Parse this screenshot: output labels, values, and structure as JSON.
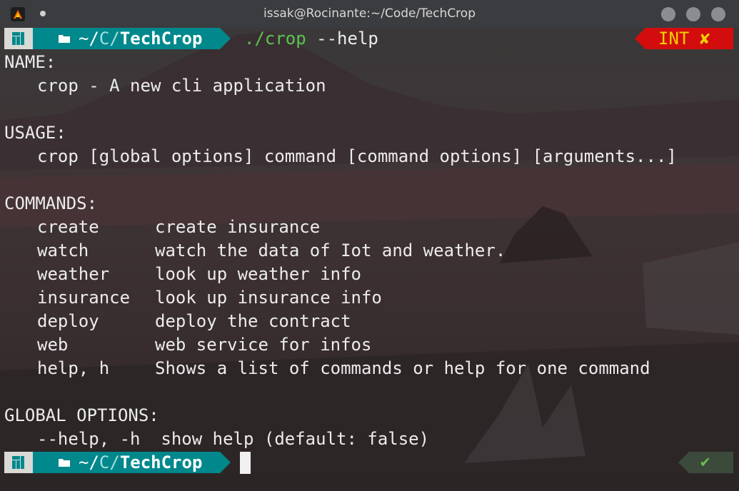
{
  "window": {
    "title": "issak@Rocinante:~/Code/TechCrop"
  },
  "prompt1": {
    "dir_home": "~/",
    "dir_mid": "C/",
    "dir_name": "TechCrop",
    "cmd_path": "./crop",
    "cmd_args": " --help"
  },
  "status_int": {
    "label": "INT",
    "icon": "✘"
  },
  "help": {
    "name_header": "NAME:",
    "name_line": "crop - A new cli application",
    "usage_header": "USAGE:",
    "usage_line": "crop [global options] command [command options] [arguments...]",
    "commands_header": "COMMANDS:",
    "commands": [
      {
        "name": "create",
        "desc": "create insurance"
      },
      {
        "name": "watch",
        "desc": "watch the data of Iot and weather."
      },
      {
        "name": "weather",
        "desc": "look up weather info"
      },
      {
        "name": "insurance",
        "desc": "look up insurance info"
      },
      {
        "name": "deploy",
        "desc": "deploy the contract"
      },
      {
        "name": "web",
        "desc": "web service for infos"
      },
      {
        "name": "help, h",
        "desc": "Shows a list of commands or help for one command"
      }
    ],
    "global_header": "GLOBAL OPTIONS:",
    "global_line": "--help, -h  show help (default: false)"
  },
  "prompt2": {
    "dir_home": "~/",
    "dir_mid": "C/",
    "dir_name": "TechCrop"
  },
  "status_ok": {
    "icon": "✔"
  },
  "colors": {
    "dir_segment": "#00888c",
    "os_segment": "#d9d9d6",
    "error_segment": "#d30d0d",
    "error_text": "#f0d000",
    "command_path": "#5ec34f",
    "ok_check": "#6cc04a"
  },
  "icons": {
    "app": "terminal-app-icon",
    "os": "manjaro-logo-icon",
    "dir": "folder-icon"
  }
}
